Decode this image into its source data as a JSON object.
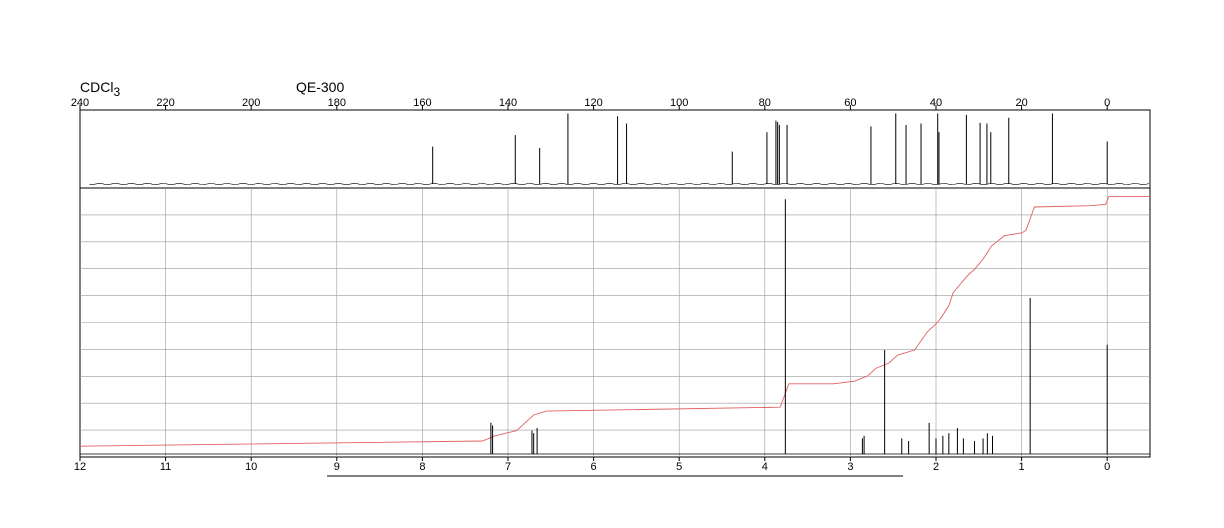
{
  "header": {
    "solvent": "CDCl",
    "solvent_subscript": "3",
    "instrument": "QE-300"
  },
  "colors": {
    "axis": "#000000",
    "grid": "#9a9a9a",
    "spectrum": "#000000",
    "integral": "#e06060"
  },
  "chart_data": [
    {
      "type": "line",
      "title": "",
      "xlabel": "",
      "ylabel": "",
      "x_reversed": true,
      "xlim": [
        240,
        -10
      ],
      "tick_values": [
        240,
        220,
        200,
        180,
        160,
        140,
        120,
        100,
        80,
        60,
        40,
        20,
        0
      ],
      "tick_labels": [
        "240",
        "220",
        "200",
        "180",
        "160",
        "140",
        "120",
        "100",
        "80",
        "60",
        "40",
        "20",
        "0"
      ],
      "grid": false,
      "peaks_ppm": [
        157.6,
        138.3,
        132.6,
        126.0,
        114.4,
        112.3,
        87.6,
        79.5,
        77.4,
        77.0,
        76.6,
        74.8,
        55.2,
        49.4,
        47.0,
        43.5,
        39.6,
        39.3,
        32.9,
        29.7,
        28.1,
        27.2,
        23.0,
        12.8,
        0.0
      ],
      "peaks_rel_height": [
        0.52,
        0.68,
        0.5,
        0.98,
        0.94,
        0.84,
        0.45,
        0.72,
        0.88,
        0.86,
        0.82,
        0.82,
        0.8,
        0.98,
        0.82,
        0.84,
        0.98,
        0.72,
        0.96,
        0.85,
        0.84,
        0.72,
        0.92,
        0.98,
        0.59
      ]
    },
    {
      "type": "line",
      "title": "",
      "xlabel": "",
      "ylabel": "",
      "x_reversed": true,
      "xlim": [
        12,
        -0.5
      ],
      "tick_values": [
        12,
        11,
        10,
        9,
        8,
        7,
        6,
        5,
        4,
        3,
        2,
        1,
        0
      ],
      "tick_labels": [
        "12",
        "11",
        "10",
        "9",
        "8",
        "7",
        "6",
        "5",
        "4",
        "3",
        "2",
        "1",
        "0"
      ],
      "grid": true,
      "peaks_ppm": [
        7.2,
        7.18,
        6.72,
        6.7,
        6.66,
        3.76,
        2.86,
        2.84,
        2.6,
        2.4,
        2.32,
        2.08,
        2.0,
        1.92,
        1.85,
        1.75,
        1.68,
        1.55,
        1.45,
        1.4,
        1.34,
        0.9,
        0.0
      ],
      "peaks_rel_height": [
        0.12,
        0.11,
        0.09,
        0.08,
        0.1,
        0.98,
        0.06,
        0.07,
        0.4,
        0.06,
        0.05,
        0.12,
        0.06,
        0.07,
        0.08,
        0.1,
        0.06,
        0.05,
        0.06,
        0.08,
        0.07,
        0.6,
        0.42
      ],
      "integral": {
        "x": [
          12,
          7.3,
          7.15,
          6.9,
          6.8,
          6.7,
          6.55,
          3.82,
          3.72,
          3.2,
          2.95,
          2.8,
          2.7,
          2.55,
          2.45,
          2.25,
          2.1,
          2.0,
          1.95,
          1.85,
          1.8,
          1.7,
          1.62,
          1.55,
          1.45,
          1.35,
          1.2,
          1.0,
          0.95,
          0.85,
          0.2,
          0.02,
          -0.02,
          -0.5
        ],
        "y": [
          0.03,
          0.05,
          0.07,
          0.09,
          0.12,
          0.15,
          0.165,
          0.18,
          0.27,
          0.27,
          0.28,
          0.3,
          0.33,
          0.35,
          0.38,
          0.4,
          0.47,
          0.5,
          0.52,
          0.57,
          0.62,
          0.66,
          0.69,
          0.71,
          0.75,
          0.8,
          0.84,
          0.85,
          0.86,
          0.95,
          0.955,
          0.96,
          0.99,
          0.99
        ]
      }
    }
  ]
}
